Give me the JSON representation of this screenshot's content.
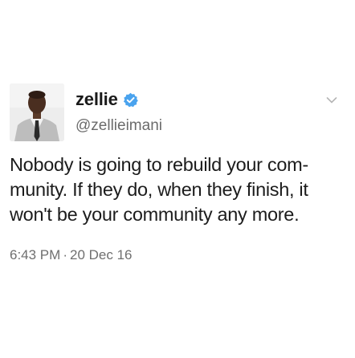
{
  "user": {
    "display_name": "zellie",
    "handle": "@zellieimani",
    "verified": true,
    "avatar_icon": "profile-photo",
    "verified_icon": "verified-badge-icon",
    "verified_color": "#4aa3ee"
  },
  "menu": {
    "icon": "chevron-down-icon"
  },
  "tweet": {
    "lines": [
      "Nobody is going to rebuild your com-",
      "munity. If they do, when they finish, it",
      "won't be your community any more."
    ]
  },
  "meta": {
    "time": "6:43 PM",
    "separator": "·",
    "date": "20 Dec 16"
  }
}
